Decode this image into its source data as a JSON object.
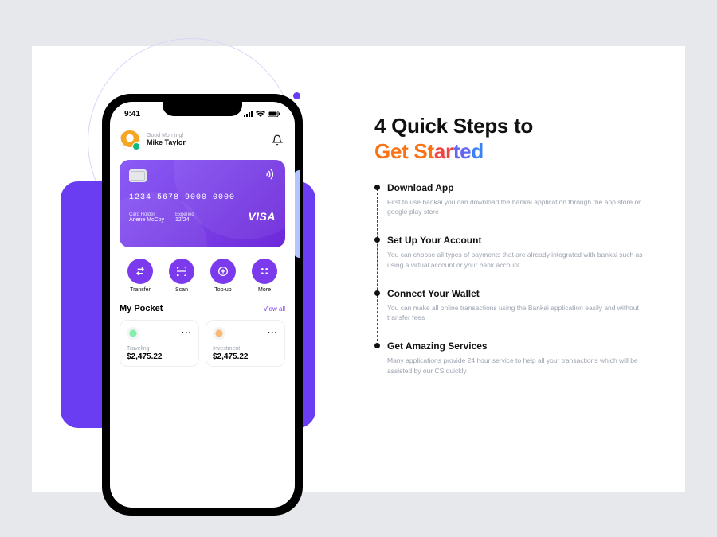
{
  "phone": {
    "time": "9:41",
    "greeting": "Good Morning!",
    "username": "Mike Taylor",
    "card": {
      "number": "1234  5678  9000  0000",
      "holder_label": "Card Holder",
      "holder": "Arlene McCoy",
      "exp_label": "Experied",
      "exp": "12/24",
      "brand": "VISA"
    },
    "actions": [
      {
        "label": "Transfer",
        "icon": "transfer-icon"
      },
      {
        "label": "Scan",
        "icon": "scan-icon"
      },
      {
        "label": "Top-up",
        "icon": "topup-icon"
      },
      {
        "label": "More",
        "icon": "more-icon"
      }
    ],
    "pocket": {
      "title": "My Pocket",
      "view_all": "View all",
      "items": [
        {
          "label": "Traveling",
          "amount": "$2,475.22"
        },
        {
          "label": "Investment",
          "amount": "$2,475.22"
        }
      ]
    }
  },
  "headline": {
    "line1": "4 Quick Steps to",
    "word2": "Get Started"
  },
  "steps": [
    {
      "title": "Download App",
      "body": "First to use bankai you can download the bankai application through the app store or google play store"
    },
    {
      "title": "Set Up Your Account",
      "body": "You can choose all types of payments that are already integrated with bankai such as using a virtual account or your bank account"
    },
    {
      "title": "Connect Your Wallet",
      "body": "You can make all online transactions using the Bankai application easily and without transfer fees"
    },
    {
      "title": "Get Amazing Services",
      "body": "Many applications provide 24 hour service to help all your transactions which will be assisted by our CS quickly"
    }
  ]
}
